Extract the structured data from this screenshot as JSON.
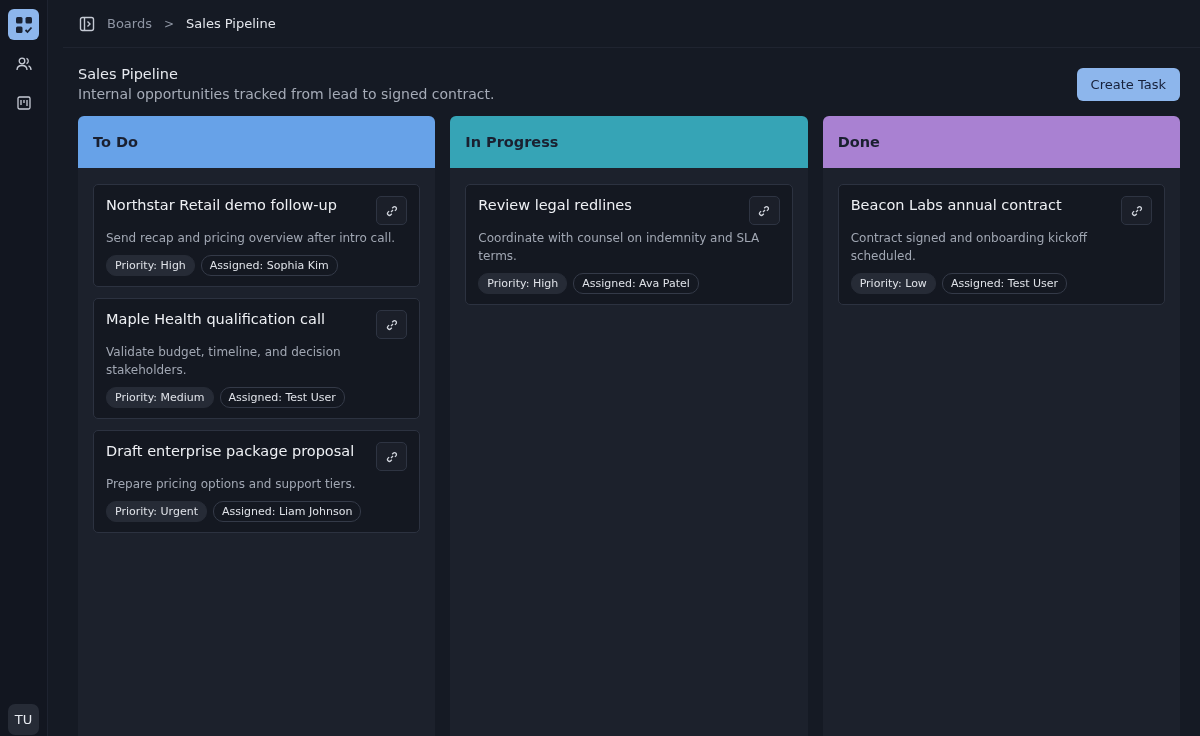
{
  "sidebar": {
    "items": [
      {
        "kind": "boards",
        "selected": true
      },
      {
        "kind": "people",
        "selected": false
      },
      {
        "kind": "kanban",
        "selected": false
      }
    ],
    "avatar": "TU"
  },
  "breadcrumb": {
    "items": [
      "Boards",
      "Sales Pipeline"
    ],
    "separator": ">"
  },
  "header": {
    "title": "Sales Pipeline",
    "subtitle": "Internal opportunities tracked from lead to signed contract.",
    "button": "Create Task"
  },
  "columns": [
    {
      "title": "To Do",
      "color": "#67a2e8",
      "cards": [
        {
          "title": "Northstar Retail demo follow-up",
          "description": "Send recap and pricing overview after intro call.",
          "tags": [
            "Priority: High",
            "Assigned: Sophia Kim"
          ]
        },
        {
          "title": "Maple Health qualification call",
          "description": "Validate budget, timeline, and decision stakeholders.",
          "tags": [
            "Priority: Medium",
            "Assigned: Test User"
          ]
        },
        {
          "title": "Draft enterprise package proposal",
          "description": "Prepare pricing options and support tiers.",
          "tags": [
            "Priority: Urgent",
            "Assigned: Liam Johnson"
          ]
        }
      ]
    },
    {
      "title": "In Progress",
      "color": "#36a4b6",
      "cards": [
        {
          "title": "Review legal redlines",
          "description": "Coordinate with counsel on indemnity and SLA terms.",
          "tags": [
            "Priority: High",
            "Assigned: Ava Patel"
          ]
        }
      ]
    },
    {
      "title": "Done",
      "color": "#a981d2",
      "cards": [
        {
          "title": "Beacon Labs annual contract",
          "description": "Contract signed and onboarding kickoff scheduled.",
          "tags": [
            "Priority: Low",
            "Assigned: Test User"
          ]
        }
      ]
    }
  ]
}
